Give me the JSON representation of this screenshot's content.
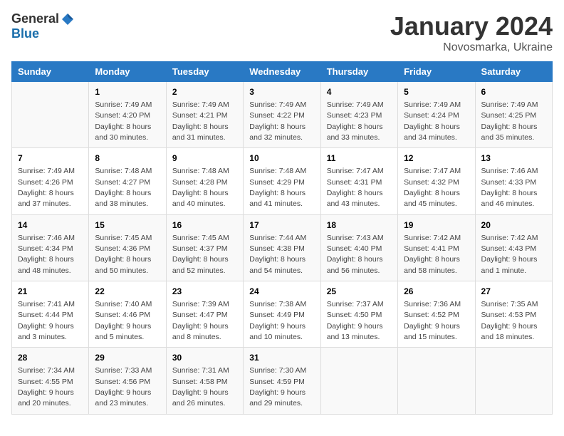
{
  "logo": {
    "general": "General",
    "blue": "Blue"
  },
  "title": "January 2024",
  "subtitle": "Novosmarka, Ukraine",
  "days_header": [
    "Sunday",
    "Monday",
    "Tuesday",
    "Wednesday",
    "Thursday",
    "Friday",
    "Saturday"
  ],
  "weeks": [
    [
      {
        "day": "",
        "info": ""
      },
      {
        "day": "1",
        "info": "Sunrise: 7:49 AM\nSunset: 4:20 PM\nDaylight: 8 hours\nand 30 minutes."
      },
      {
        "day": "2",
        "info": "Sunrise: 7:49 AM\nSunset: 4:21 PM\nDaylight: 8 hours\nand 31 minutes."
      },
      {
        "day": "3",
        "info": "Sunrise: 7:49 AM\nSunset: 4:22 PM\nDaylight: 8 hours\nand 32 minutes."
      },
      {
        "day": "4",
        "info": "Sunrise: 7:49 AM\nSunset: 4:23 PM\nDaylight: 8 hours\nand 33 minutes."
      },
      {
        "day": "5",
        "info": "Sunrise: 7:49 AM\nSunset: 4:24 PM\nDaylight: 8 hours\nand 34 minutes."
      },
      {
        "day": "6",
        "info": "Sunrise: 7:49 AM\nSunset: 4:25 PM\nDaylight: 8 hours\nand 35 minutes."
      }
    ],
    [
      {
        "day": "7",
        "info": "Sunrise: 7:49 AM\nSunset: 4:26 PM\nDaylight: 8 hours\nand 37 minutes."
      },
      {
        "day": "8",
        "info": "Sunrise: 7:48 AM\nSunset: 4:27 PM\nDaylight: 8 hours\nand 38 minutes."
      },
      {
        "day": "9",
        "info": "Sunrise: 7:48 AM\nSunset: 4:28 PM\nDaylight: 8 hours\nand 40 minutes."
      },
      {
        "day": "10",
        "info": "Sunrise: 7:48 AM\nSunset: 4:29 PM\nDaylight: 8 hours\nand 41 minutes."
      },
      {
        "day": "11",
        "info": "Sunrise: 7:47 AM\nSunset: 4:31 PM\nDaylight: 8 hours\nand 43 minutes."
      },
      {
        "day": "12",
        "info": "Sunrise: 7:47 AM\nSunset: 4:32 PM\nDaylight: 8 hours\nand 45 minutes."
      },
      {
        "day": "13",
        "info": "Sunrise: 7:46 AM\nSunset: 4:33 PM\nDaylight: 8 hours\nand 46 minutes."
      }
    ],
    [
      {
        "day": "14",
        "info": "Sunrise: 7:46 AM\nSunset: 4:34 PM\nDaylight: 8 hours\nand 48 minutes."
      },
      {
        "day": "15",
        "info": "Sunrise: 7:45 AM\nSunset: 4:36 PM\nDaylight: 8 hours\nand 50 minutes."
      },
      {
        "day": "16",
        "info": "Sunrise: 7:45 AM\nSunset: 4:37 PM\nDaylight: 8 hours\nand 52 minutes."
      },
      {
        "day": "17",
        "info": "Sunrise: 7:44 AM\nSunset: 4:38 PM\nDaylight: 8 hours\nand 54 minutes."
      },
      {
        "day": "18",
        "info": "Sunrise: 7:43 AM\nSunset: 4:40 PM\nDaylight: 8 hours\nand 56 minutes."
      },
      {
        "day": "19",
        "info": "Sunrise: 7:42 AM\nSunset: 4:41 PM\nDaylight: 8 hours\nand 58 minutes."
      },
      {
        "day": "20",
        "info": "Sunrise: 7:42 AM\nSunset: 4:43 PM\nDaylight: 9 hours\nand 1 minute."
      }
    ],
    [
      {
        "day": "21",
        "info": "Sunrise: 7:41 AM\nSunset: 4:44 PM\nDaylight: 9 hours\nand 3 minutes."
      },
      {
        "day": "22",
        "info": "Sunrise: 7:40 AM\nSunset: 4:46 PM\nDaylight: 9 hours\nand 5 minutes."
      },
      {
        "day": "23",
        "info": "Sunrise: 7:39 AM\nSunset: 4:47 PM\nDaylight: 9 hours\nand 8 minutes."
      },
      {
        "day": "24",
        "info": "Sunrise: 7:38 AM\nSunset: 4:49 PM\nDaylight: 9 hours\nand 10 minutes."
      },
      {
        "day": "25",
        "info": "Sunrise: 7:37 AM\nSunset: 4:50 PM\nDaylight: 9 hours\nand 13 minutes."
      },
      {
        "day": "26",
        "info": "Sunrise: 7:36 AM\nSunset: 4:52 PM\nDaylight: 9 hours\nand 15 minutes."
      },
      {
        "day": "27",
        "info": "Sunrise: 7:35 AM\nSunset: 4:53 PM\nDaylight: 9 hours\nand 18 minutes."
      }
    ],
    [
      {
        "day": "28",
        "info": "Sunrise: 7:34 AM\nSunset: 4:55 PM\nDaylight: 9 hours\nand 20 minutes."
      },
      {
        "day": "29",
        "info": "Sunrise: 7:33 AM\nSunset: 4:56 PM\nDaylight: 9 hours\nand 23 minutes."
      },
      {
        "day": "30",
        "info": "Sunrise: 7:31 AM\nSunset: 4:58 PM\nDaylight: 9 hours\nand 26 minutes."
      },
      {
        "day": "31",
        "info": "Sunrise: 7:30 AM\nSunset: 4:59 PM\nDaylight: 9 hours\nand 29 minutes."
      },
      {
        "day": "",
        "info": ""
      },
      {
        "day": "",
        "info": ""
      },
      {
        "day": "",
        "info": ""
      }
    ]
  ]
}
